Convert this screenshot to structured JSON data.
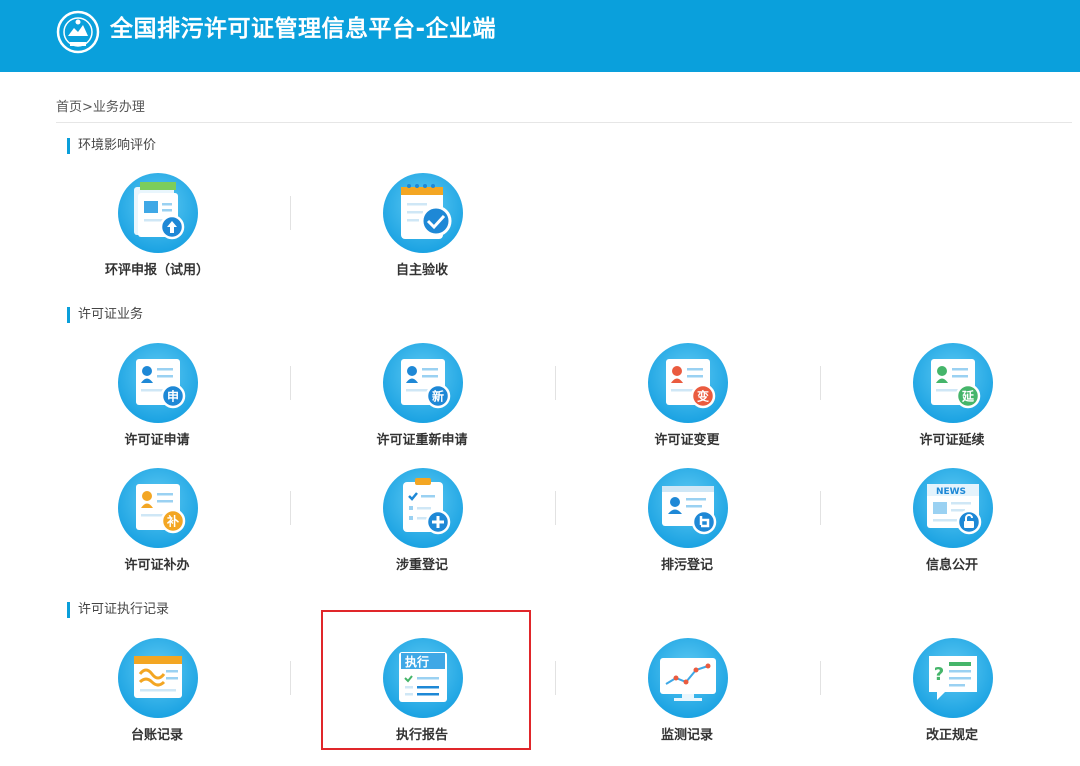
{
  "header": {
    "title": "全国排污许可证管理信息平台-企业端"
  },
  "breadcrumb": "首页>业务办理",
  "sections": [
    {
      "title": "环境影响评价"
    },
    {
      "title": "许可证业务"
    },
    {
      "title": "许可证执行记录"
    }
  ],
  "tiles": {
    "eia_report": {
      "label": "环评申报（试用）"
    },
    "self_acceptance": {
      "label": "自主验收"
    },
    "permit_apply": {
      "label": "许可证申请",
      "badge": "申"
    },
    "permit_reapply": {
      "label": "许可证重新申请",
      "badge": "新"
    },
    "permit_change": {
      "label": "许可证变更",
      "badge": "变"
    },
    "permit_renew": {
      "label": "许可证延续",
      "badge": "延"
    },
    "permit_supplement": {
      "label": "许可证补办",
      "badge": "补"
    },
    "heavy_register": {
      "label": "涉重登记"
    },
    "discharge_register": {
      "label": "排污登记"
    },
    "info_public": {
      "label": "信息公开",
      "news": "NEWS"
    },
    "ledger_record": {
      "label": "台账记录"
    },
    "exec_report": {
      "label": "执行报告",
      "banner": "执行"
    },
    "monitor_record": {
      "label": "监测记录"
    },
    "correction_rules": {
      "label": "改正规定"
    }
  },
  "colors": {
    "header_bg": "#0aa0dc",
    "icon_blue": "#29aee8",
    "badge_blue": "#1e88d6",
    "badge_red": "#ea5b3f",
    "badge_green": "#45b56a",
    "badge_orange": "#f3a623",
    "highlight": "#e0262a"
  }
}
